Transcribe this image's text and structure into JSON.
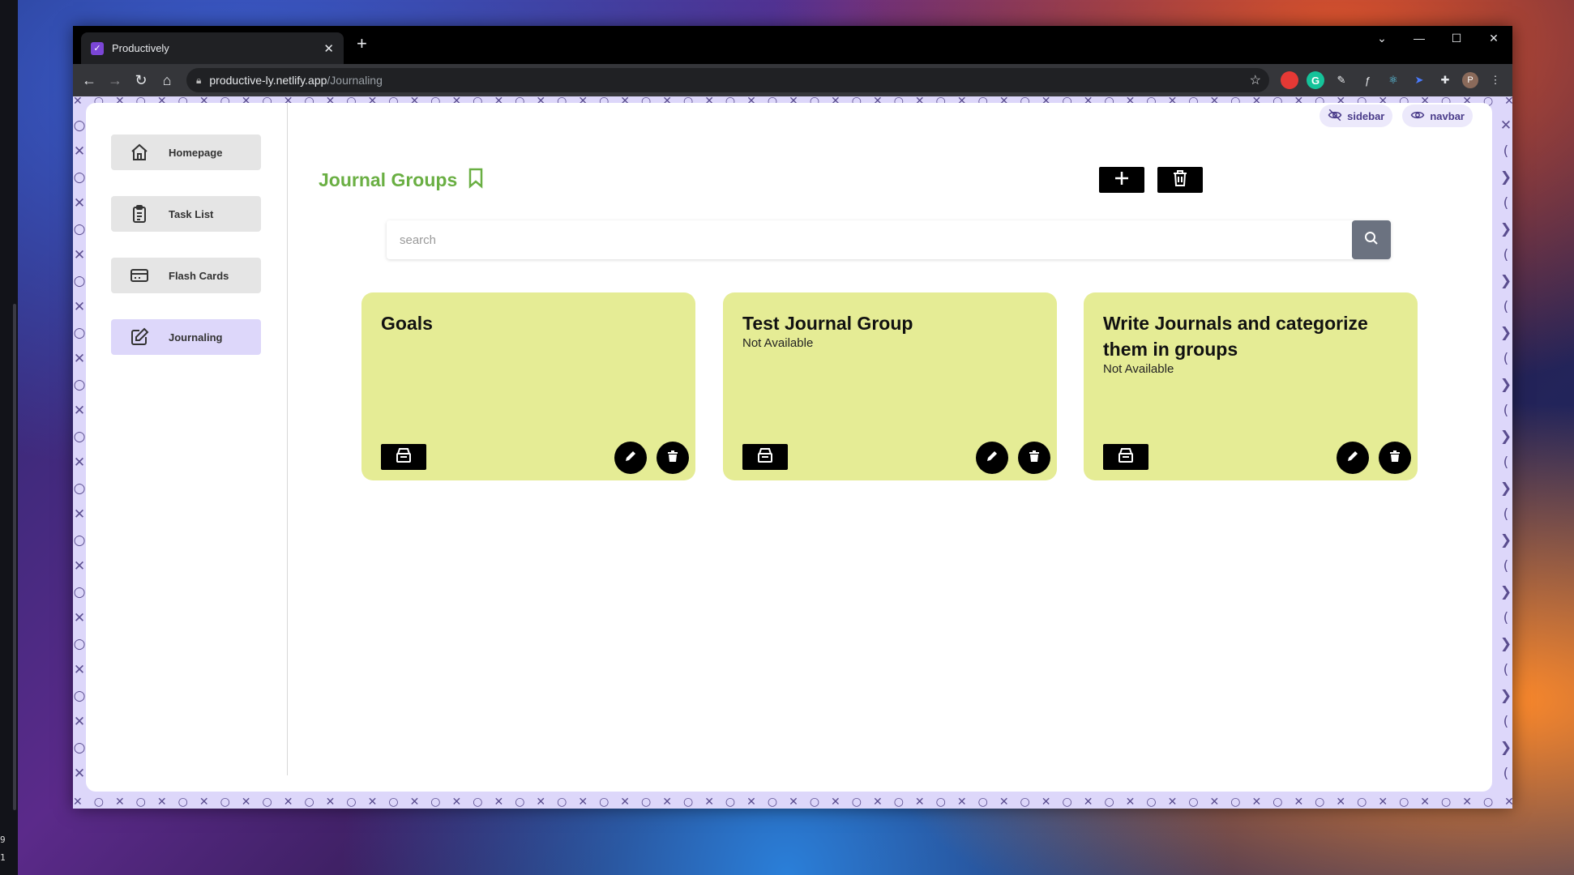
{
  "browser": {
    "tab_title": "Productively",
    "url_host": "productive-ly.netlify.app",
    "url_path": "/Journaling"
  },
  "taskbar": {
    "clock_line1": "9",
    "clock_line2": "1"
  },
  "view_toggles": {
    "sidebar_label": "sidebar",
    "navbar_label": "navbar"
  },
  "sidebar": {
    "items": [
      {
        "label": "Homepage",
        "icon": "home-icon"
      },
      {
        "label": "Task List",
        "icon": "clipboard-icon"
      },
      {
        "label": "Flash Cards",
        "icon": "card-icon"
      },
      {
        "label": "Journaling",
        "icon": "edit-icon",
        "active": true
      }
    ]
  },
  "main": {
    "heading": "Journal Groups",
    "search": {
      "placeholder": "search"
    },
    "cards": [
      {
        "title": "Goals",
        "subtitle": ""
      },
      {
        "title": "Test Journal Group",
        "subtitle": "Not Available"
      },
      {
        "title": "Write Journals and categorize them in groups",
        "subtitle": "Not Available"
      }
    ]
  },
  "colors": {
    "accent": "#ddd7fa",
    "heading_green": "#6aaf43",
    "card_bg": "#e5ec95",
    "toggle_text": "#4a3c8a"
  }
}
